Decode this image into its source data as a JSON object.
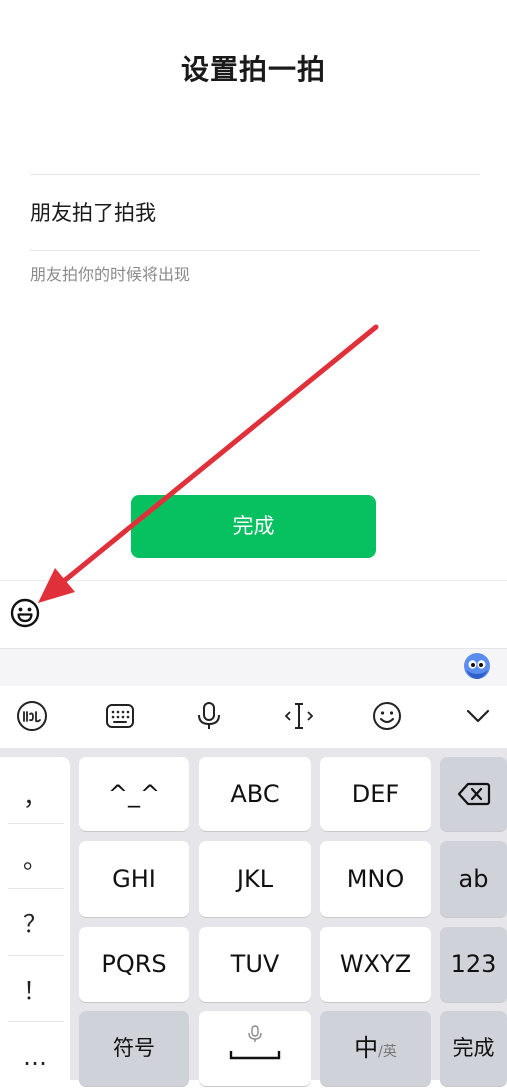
{
  "page": {
    "title": "设置拍一拍",
    "field_value": "朋友拍了拍我",
    "hint": "朋友拍你的时候将出现",
    "done_button": "完成"
  },
  "colors": {
    "primary_green": "#07c160",
    "annotation_arrow": "#e0313b"
  },
  "emoji_bar": {
    "icon": "smiley-icon"
  },
  "ime_toolbar": {
    "icons": [
      "keyboard-brand-icon",
      "keyboard-layout-icon",
      "microphone-icon",
      "text-cursor-icon",
      "emoji-face-icon",
      "collapse-chevron-icon"
    ]
  },
  "keyboard": {
    "punctuation": [
      "，",
      "。",
      "？",
      "！",
      "…"
    ],
    "rows": [
      [
        "^_^",
        "ABC",
        "DEF"
      ],
      [
        "GHI",
        "JKL",
        "MNO",
        "ab"
      ],
      [
        "PQRS",
        "TUV",
        "WXYZ",
        "123"
      ],
      [
        "符号",
        "",
        "中",
        "完成"
      ]
    ],
    "lang_sub": "/英"
  }
}
